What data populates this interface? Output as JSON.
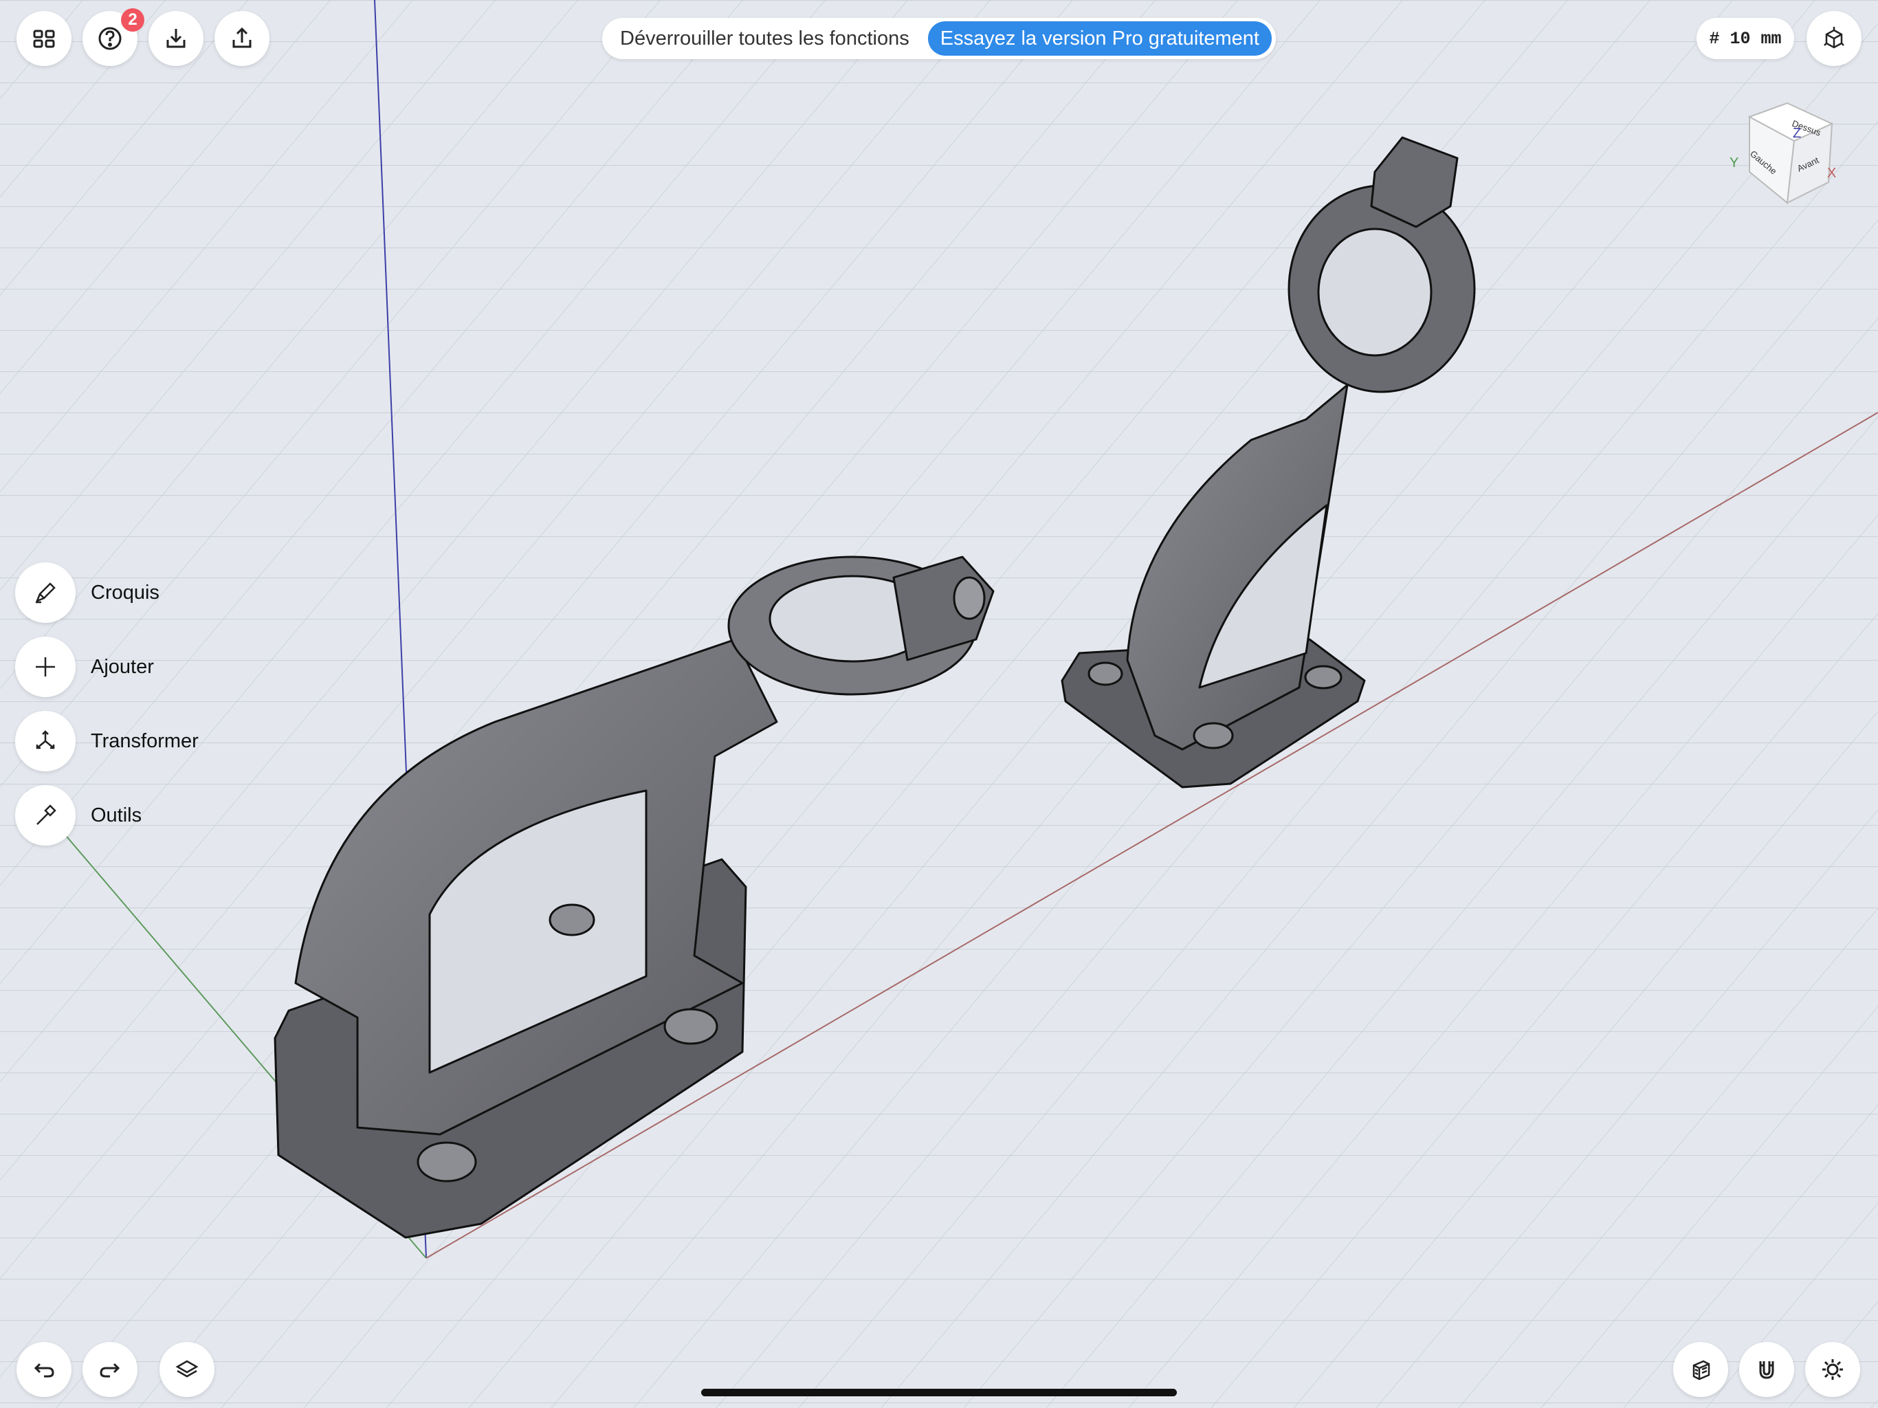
{
  "toolbar": {
    "help_badge": "2"
  },
  "promo": {
    "text": "Déverrouiller toutes les fonctions",
    "button": "Essayez la version Pro gratuitement"
  },
  "grid": {
    "label": "# 10 mm"
  },
  "view_cube": {
    "top": "Dessus",
    "left": "Gauche",
    "front": "Avant",
    "axis_z": "Z",
    "axis_y": "Y",
    "axis_x": "X"
  },
  "tools": [
    {
      "label": "Croquis",
      "icon": "pencil-icon"
    },
    {
      "label": "Ajouter",
      "icon": "plus-icon"
    },
    {
      "label": "Transformer",
      "icon": "transform-arrows-icon"
    },
    {
      "label": "Outils",
      "icon": "hammer-icon"
    }
  ],
  "colors": {
    "accent": "#2f8ae8",
    "badge": "#f0555f",
    "part": "#6d6e73",
    "background": "#e4e8ee"
  }
}
